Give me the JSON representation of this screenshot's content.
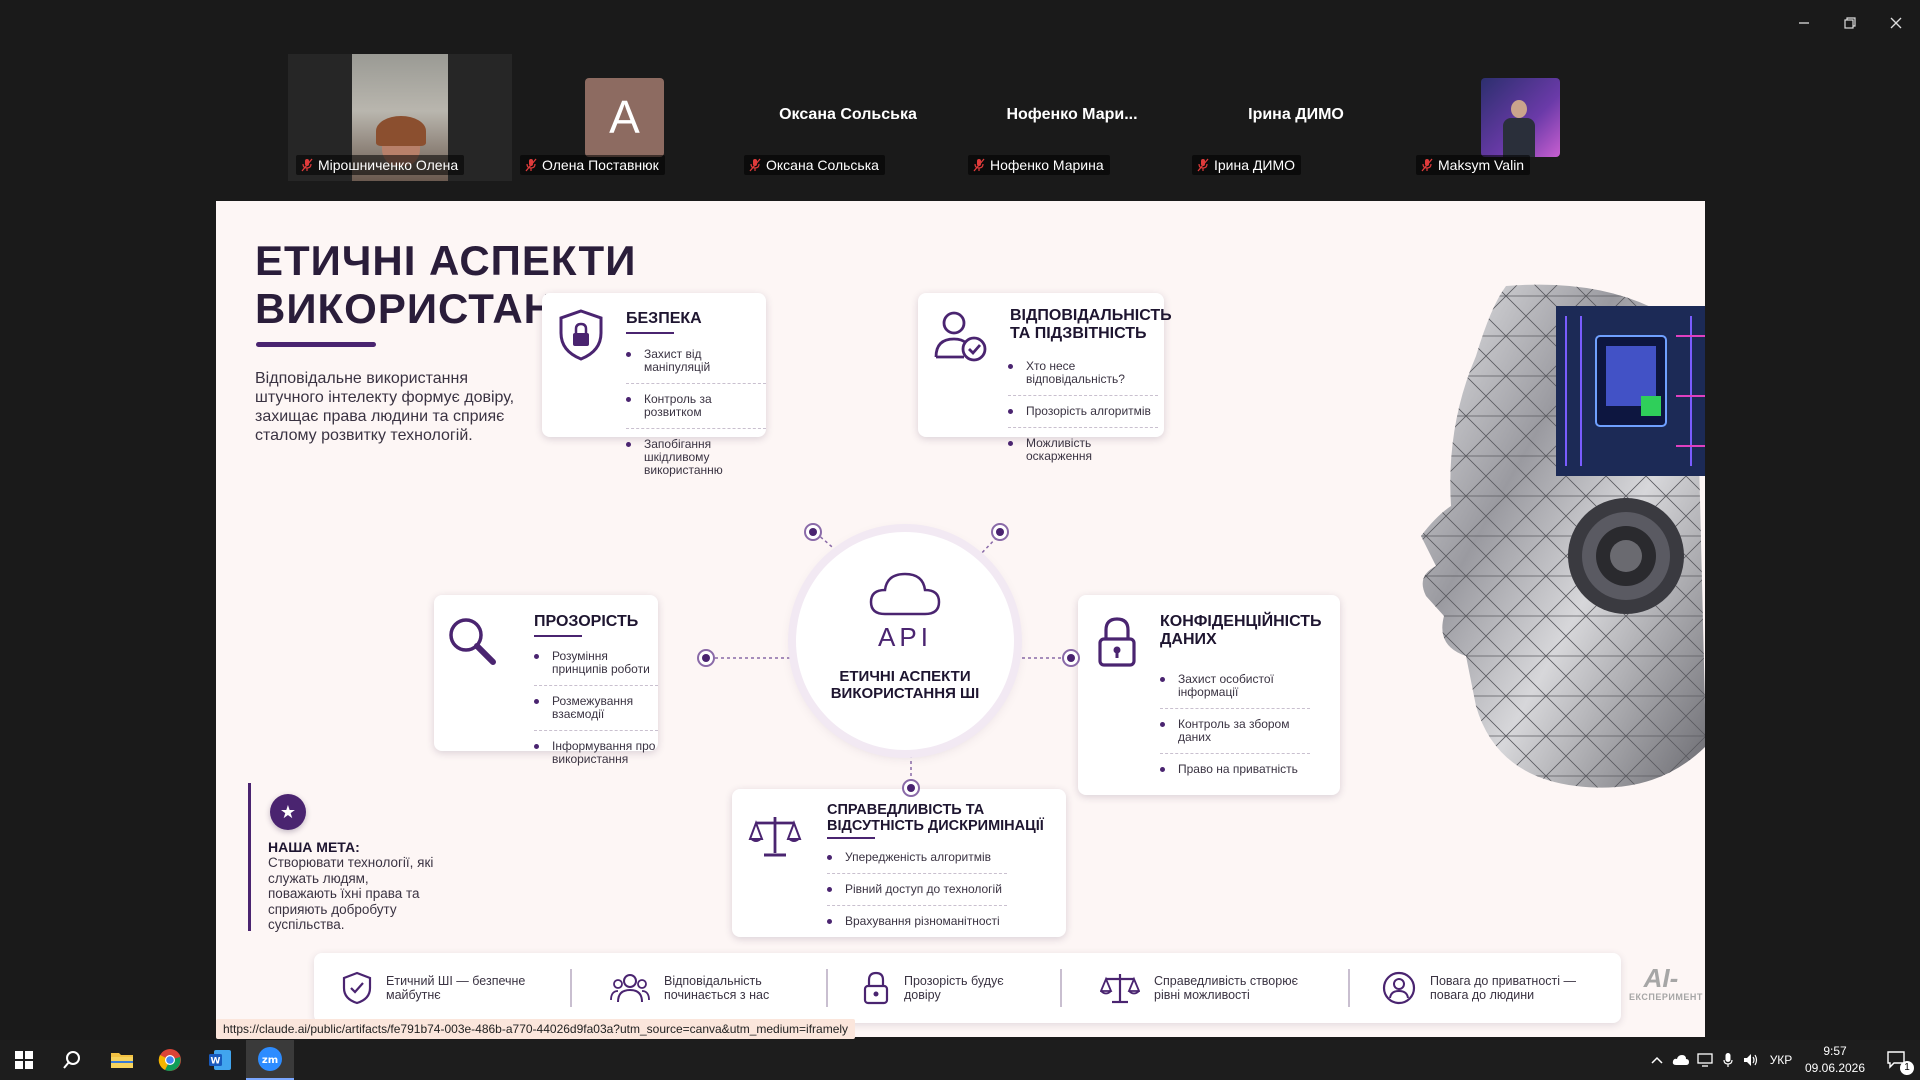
{
  "window_controls": {
    "minimize": "–",
    "restore": "❐",
    "close": "✕"
  },
  "participants": [
    {
      "name": "Мірошниченко Олена",
      "type": "video"
    },
    {
      "name": "Олена Поставнюк",
      "type": "avatar",
      "avatar_letter": "A"
    },
    {
      "name": "Оксана Сольська",
      "type": "name",
      "display": "Оксана Сольська"
    },
    {
      "name": "Нофенко Марина",
      "type": "name",
      "display": "Нофенко  Мари..."
    },
    {
      "name": "Ірина ДИМО",
      "type": "name",
      "display": "Ірина ДИМО"
    },
    {
      "name": "Maksym Valin",
      "type": "video"
    }
  ],
  "slide": {
    "title_line1": "ЕТИЧНІ АСПЕКТИ",
    "title_line2": "ВИКОРИСТАННЯ ШІ",
    "intro": "Відповідальне використання штучного інтелекту формує довіру, захищає права людини та сприяє сталому розвитку технологій.",
    "center": {
      "api": "API",
      "label": "ЕТИЧНІ АСПЕКТИ ВИКОРИСТАННЯ ШІ"
    },
    "cards": {
      "security": {
        "title": "БЕЗПЕКА",
        "items": [
          "Захист від маніпуляцій",
          "Контроль за розвитком",
          "Запобігання шкідливому використанню"
        ]
      },
      "responsibility": {
        "title": "ВІДПОВІДАЛЬНІСТЬ ТА ПІДЗВІТНІСТЬ",
        "items": [
          "Хто несе відповідальність?",
          "Прозорість алгоритмів",
          "Можливість оскарження"
        ]
      },
      "transparency": {
        "title": "ПРОЗОРІСТЬ",
        "items": [
          "Розуміння принципів роботи",
          "Розмежування взаємодії",
          "Інформування про використання"
        ]
      },
      "privacy": {
        "title": "КОНФІДЕНЦІЙНІСТЬ ДАНИХ",
        "items": [
          "Захист особистої інформації",
          "Контроль за збором даних",
          "Право на приватність"
        ]
      },
      "fairness": {
        "title": "СПРАВЕДЛИВІСТЬ ТА ВІДСУТНІСТЬ ДИСКРИМІНАЦІЇ",
        "items": [
          "Упередженість алгоритмів",
          "Рівний доступ до технологій",
          "Врахування різноманітності"
        ]
      }
    },
    "goal": {
      "title": "НАША МЕТА:",
      "text": "Створювати технології, які служать людям, поважають їхні права та сприяють добробуту суспільства."
    },
    "footer": [
      {
        "icon": "shield-check-icon",
        "text": "Етичний ШІ — безпечне майбутнє"
      },
      {
        "icon": "people-icon",
        "text": "Відповідальність починається з нас"
      },
      {
        "icon": "lock-icon",
        "text": "Прозорість будує довіру"
      },
      {
        "icon": "scales-icon",
        "text": "Справедливість створює рівні можливості"
      },
      {
        "icon": "person-icon",
        "text": "Повага до приватності — повага до людини"
      }
    ],
    "brand": {
      "big": "AI-",
      "small": "ЕКСПЕРИМЕНТ"
    }
  },
  "status_url": "https://claude.ai/public/artifacts/fe791b74-003e-486b-a770-44026d9fa03a?utm_source=canva&utm_medium=iframely",
  "taskbar": {
    "apps": [
      "start-button",
      "search-button",
      "file-explorer",
      "chrome",
      "word",
      "zoom"
    ],
    "language": "УКР",
    "time": "9:57",
    "date": "09.06.2026",
    "notification_count": "1"
  },
  "colors": {
    "accent": "#4a2470",
    "slide_bg": "#fdf6f5",
    "taskbar_bg": "#1d1d1d"
  }
}
